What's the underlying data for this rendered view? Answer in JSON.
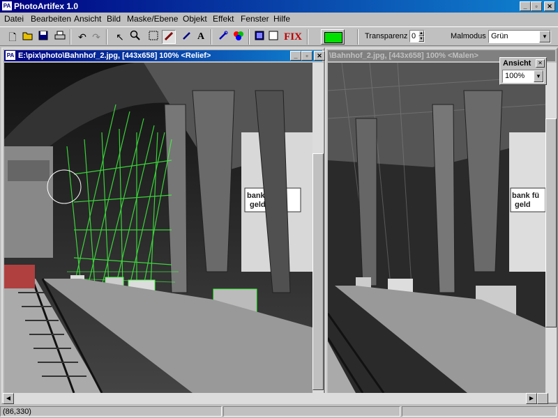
{
  "app": {
    "title": "PhotoArtifex 1.0",
    "icon": "PA"
  },
  "caption_buttons": {
    "minimize": "_",
    "maximize": "▫",
    "close": "✕"
  },
  "menu": [
    {
      "label": "Datei"
    },
    {
      "label": "Bearbeiten"
    },
    {
      "label": "Ansicht"
    },
    {
      "label": "Bild"
    },
    {
      "label": "Maske/Ebene"
    },
    {
      "label": "Objekt"
    },
    {
      "label": "Effekt"
    },
    {
      "label": "Fenster"
    },
    {
      "label": "Hilfe"
    }
  ],
  "toolbar": {
    "icons": [
      "new-file-icon",
      "open-folder-icon",
      "save-icon",
      "print-icon",
      "undo-icon",
      "redo-icon",
      "pointer-icon",
      "zoom-icon",
      "rect-select-icon",
      "brush-icon",
      "eyedropper-icon",
      "text-icon",
      "wrench-icon",
      "color-circles-icon",
      "fill-icon",
      "blank-icon"
    ],
    "fix_label": "FIX",
    "color_swatch": "#00e000",
    "transparency_label": "Transparenz",
    "transparency_value": "0",
    "paint_mode_label": "Malmodus",
    "paint_mode_value": "Grün"
  },
  "windows": {
    "relief": {
      "title": "E:\\pix\\photo\\Bahnhof_2.jpg, [443x658] 100%   <Relief>",
      "icon": "PA"
    },
    "paint": {
      "title": "\\Bahnhof_2.jpg, [443x658] 100%   <Malen>"
    }
  },
  "view_palette": {
    "title": "Ansicht",
    "zoom": "100%"
  },
  "photo_text": {
    "sign1": "bank fü",
    "sign2": "geld"
  },
  "status": {
    "coords": "(86,330)"
  },
  "colors": {
    "titlebar_active": "#000080",
    "titlebar_inactive": "#808080",
    "effect_green": "#40ff40"
  }
}
